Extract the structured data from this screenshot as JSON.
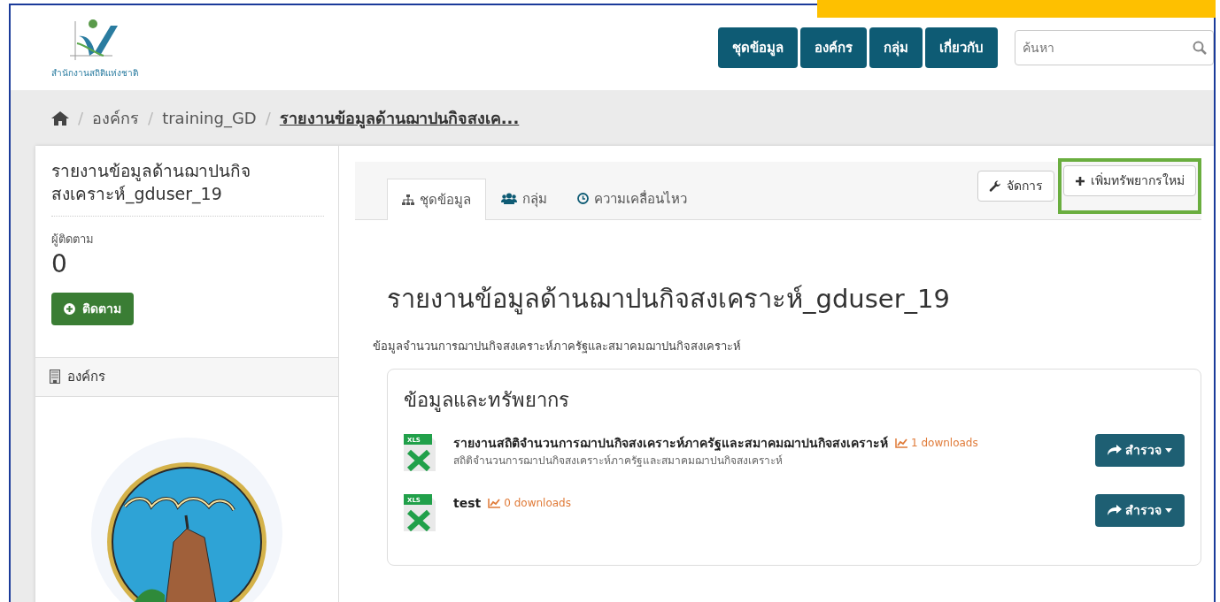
{
  "logo": {
    "caption": "สำนักงานสถิติแห่งชาติ"
  },
  "nav": [
    {
      "label": "ชุดข้อมูล"
    },
    {
      "label": "องค์กร"
    },
    {
      "label": "กลุ่ม"
    },
    {
      "label": "เกี่ยวกับ"
    }
  ],
  "search": {
    "placeholder": "ค้นหา"
  },
  "breadcrumb": [
    {
      "separator": "/",
      "label": "องค์กร",
      "current": false
    },
    {
      "separator": "/",
      "label": "training_GD",
      "current": false
    },
    {
      "separator": "/",
      "label": "รายงานข้อมูลด้านฌาปนกิจสงเค...",
      "current": true
    }
  ],
  "sidebar": {
    "title": "รายงานข้อมูลด้านฌาปนกิจสงเคราะห์_gduser_19",
    "followers_label": "ผู้ติดตาม",
    "followers_count": "0",
    "follow_button": "ติดตาม",
    "org_heading": "องค์กร"
  },
  "tabs": [
    {
      "label": "ชุดข้อมูล",
      "selected": true
    },
    {
      "label": "กลุ่ม",
      "selected": false
    },
    {
      "label": "ความเคลื่อนไหว",
      "selected": false
    }
  ],
  "actions": [
    {
      "label": "จัดการ",
      "highlighted": false
    },
    {
      "label": "เพิ่มทรัพยากรใหม่",
      "highlighted": true
    }
  ],
  "dataset": {
    "title": "รายงานข้อมูลด้านฌาปนกิจสงเคราะห์_gduser_19",
    "description": "ข้อมูลจำนวนการฌาปนกิจสงเคราะห์ภาครัฐและสมาคมฌาปนกิจสงเคราะห์"
  },
  "resources": {
    "heading": "ข้อมูลและทรัพยากร",
    "items": [
      {
        "format": "XLS",
        "name": "รายงานสถิติจำนวนการฌาปนกิจสงเคราะห์ภาครัฐและสมาคมฌาปนกิจสงเคราะห์",
        "downloads": "1 downloads",
        "description": "สถิติจำนวนการฌาปนกิจสงเคราะห์ภาครัฐและสมาคมฌาปนกิจสงเคราะห์",
        "button": "สำรวจ"
      },
      {
        "format": "XLS",
        "name": "test",
        "downloads": "0 downloads",
        "button": "สำรวจ"
      }
    ]
  }
}
